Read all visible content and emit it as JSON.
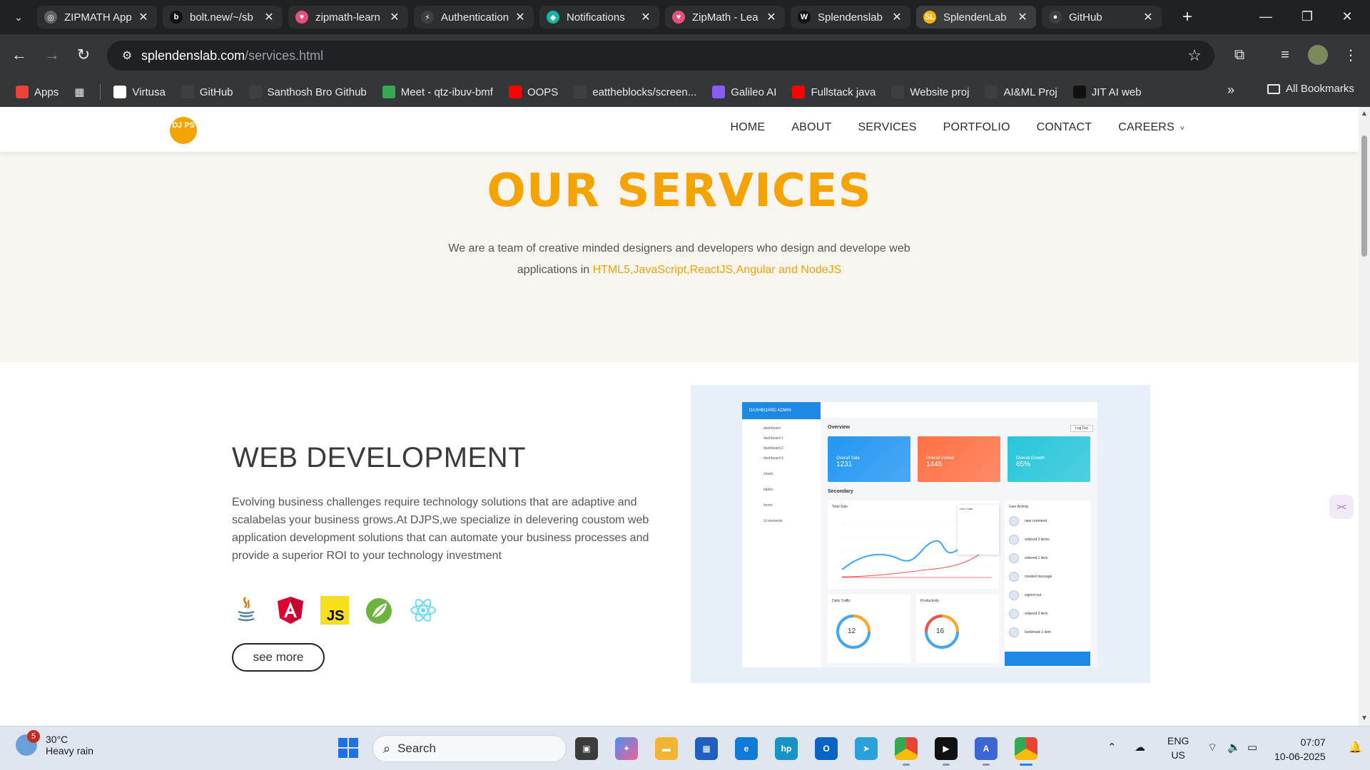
{
  "browser": {
    "tabs": [
      {
        "title": "ZIPMATH App",
        "color": "#5f6368",
        "glyph": "◎"
      },
      {
        "title": "bolt.new/~/sb",
        "color": "#111111",
        "glyph": "b"
      },
      {
        "title": "zipmath-learn",
        "color": "#e84e7a",
        "glyph": "♥"
      },
      {
        "title": "Authentication",
        "color": "#3c4043",
        "glyph": "⚡"
      },
      {
        "title": "Notifications",
        "color": "#12b5a6",
        "glyph": "◆"
      },
      {
        "title": "ZipMath - Lea",
        "color": "#e84e7a",
        "glyph": "♥"
      },
      {
        "title": "Splendenslab",
        "color": "#111111",
        "glyph": "W"
      },
      {
        "title": "SplendenLab",
        "color": "#f5b400",
        "glyph": "SL"
      },
      {
        "title": "GitHub",
        "color": "#3c4043",
        "glyph": "●"
      }
    ],
    "url_host": "splendenslab.com",
    "url_path": "/services.html",
    "bookmarks": [
      {
        "label": "Apps",
        "color": "#ea4335"
      },
      {
        "label": "Virtusa",
        "color": "#ffffff"
      },
      {
        "label": "GitHub",
        "color": "#3c4043"
      },
      {
        "label": "Santhosh Bro Github",
        "color": "#3c4043"
      },
      {
        "label": "Meet - qtz-ibuv-bmf",
        "color": "#34a853"
      },
      {
        "label": "OOPS",
        "color": "#ff0000"
      },
      {
        "label": "eattheblocks/screen...",
        "color": "#3c4043"
      },
      {
        "label": "Galileo AI",
        "color": "#8a5cf6"
      },
      {
        "label": "Fullstack java",
        "color": "#ff0000"
      },
      {
        "label": "Website proj",
        "color": "#3c4043"
      },
      {
        "label": "AI&ML Proj",
        "color": "#3c4043"
      },
      {
        "label": "JIT AI web",
        "color": "#111111"
      }
    ],
    "all_bookmarks": "All Bookmarks"
  },
  "site": {
    "logo_text": "DJ PS",
    "nav": [
      "HOME",
      "ABOUT",
      "SERVICES",
      "PORTFOLIO",
      "CONTACT",
      "CAREERS"
    ],
    "careers_caret": "˅",
    "hero": {
      "title": "OUR SERVICES",
      "text": "We are a team of creative minded designers and developers who design and develope web applications in ",
      "highlight": "HTML5,JavaScript,ReactJS,Angular and NodeJS"
    },
    "service": {
      "title": "WEB DEVELOPMENT",
      "description": "Evolving business challenges require technology solutions that are adaptive and scalabelas your business grows.At DJPS,we specialize in delevering coustom web application development solutions that can automate your business processes and provide a superior ROI to your technology investment",
      "tech_icons": [
        "java-icon",
        "angular-icon",
        "javascript-icon",
        "spring-icon",
        "react-icon"
      ],
      "js_label": "JS",
      "see_more": "see more"
    },
    "dashboard": {
      "brand": "DASHBOARD ADMIN",
      "menu": [
        "dashboard",
        "dashboard 1",
        "dashboard 2",
        "dashboard 3",
        "charts",
        "tables",
        "forms",
        "UI elements"
      ],
      "overview": "Overview",
      "secondary": "Secondary",
      "logout": "Log Out",
      "cards": [
        {
          "label": "Overall Sale",
          "value": "1231",
          "color": "#2196f3"
        },
        {
          "label": "Overall Visited",
          "value": "1446",
          "color": "#ff7043"
        },
        {
          "label": "Overall Growth",
          "value": "65%",
          "color": "#26c6da"
        }
      ],
      "total_sale": "Total Sale",
      "line_chart": "Line Chart",
      "user_activity": "User Activity",
      "daily_traffic": "Daily Traffic",
      "daily_value": "12",
      "productivity": "Productivity",
      "productivity_value": "16",
      "activity": [
        "new comment",
        "ordered 2 items",
        "ordered 1 item",
        "created message",
        "signed out",
        "ordered 2 item",
        "bookmark 1 item"
      ]
    }
  },
  "taskbar": {
    "weather_temp": "30°C",
    "weather_desc": "Heavy rain",
    "weather_badge": "5",
    "search": "Search",
    "lang": "ENG",
    "region": "US",
    "time": "07:07",
    "date": "10-06-2025"
  }
}
